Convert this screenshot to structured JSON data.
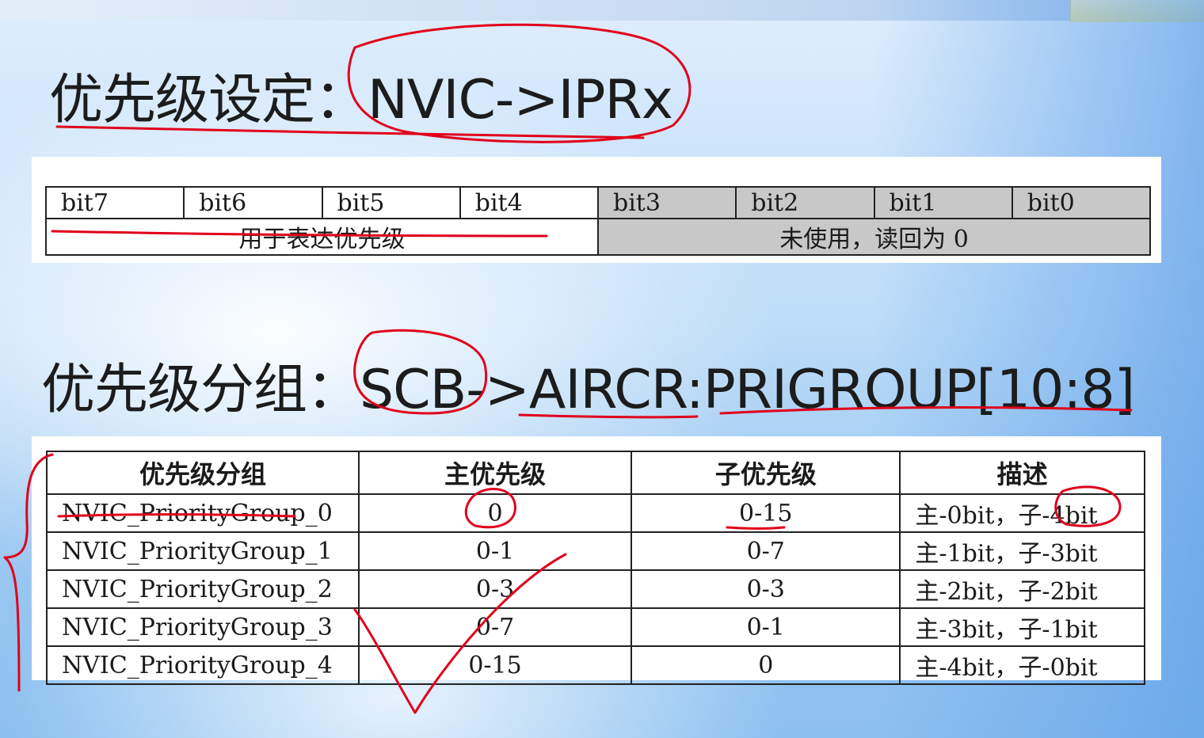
{
  "heading1": {
    "prefix": "优先级设定：",
    "code": "NVIC->IPRx"
  },
  "bits_table": {
    "bits": [
      "bit7",
      "bit6",
      "bit5",
      "bit4",
      "bit3",
      "bit2",
      "bit1",
      "bit0"
    ],
    "used_label": "用于表达优先级",
    "unused_label": "未使用，读回为 0"
  },
  "heading2": {
    "prefix": "优先级分组：",
    "code": "SCB->AIRCR:PRIGROUP[10:8]"
  },
  "group_table": {
    "headers": [
      "优先级分组",
      "主优先级",
      "子优先级",
      "描述"
    ],
    "rows": [
      {
        "group": "NVIC_PriorityGroup_0",
        "main": "0",
        "sub": "0-15",
        "desc": "主-0bit，子-4bit"
      },
      {
        "group": "NVIC_PriorityGroup_1",
        "main": "0-1",
        "sub": "0-7",
        "desc": "主-1bit，子-3bit"
      },
      {
        "group": "NVIC_PriorityGroup_2",
        "main": "0-3",
        "sub": "0-3",
        "desc": "主-2bit，子-2bit"
      },
      {
        "group": "NVIC_PriorityGroup_3",
        "main": "0-7",
        "sub": "0-1",
        "desc": "主-3bit，子-1bit"
      },
      {
        "group": "NVIC_PriorityGroup_4",
        "main": "0-15",
        "sub": "0",
        "desc": "主-4bit，子-0bit"
      }
    ]
  },
  "annotation_color": "#e0001b"
}
